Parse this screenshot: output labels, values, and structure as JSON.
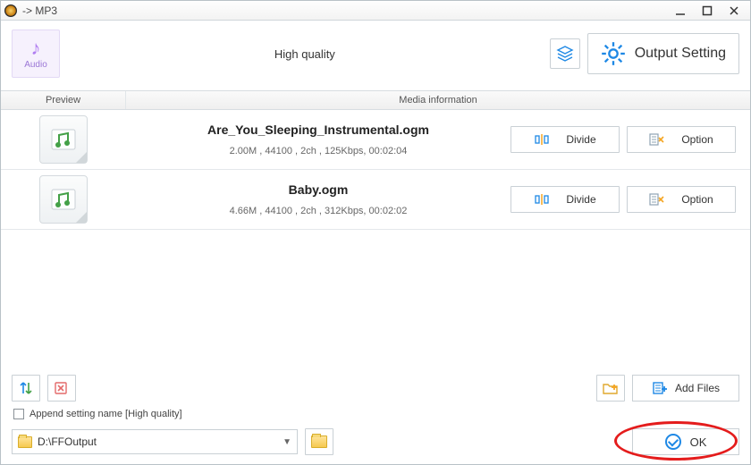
{
  "titlebar": {
    "title": " -> MP3"
  },
  "topbar": {
    "audio_label": "Audio",
    "quality_label": "High quality",
    "output_setting_label": "Output Setting"
  },
  "columns": {
    "preview": "Preview",
    "media": "Media information"
  },
  "files": [
    {
      "name": "Are_You_Sleeping_Instrumental.ogm",
      "meta": "2.00M , 44100 , 2ch , 125Kbps, 00:02:04"
    },
    {
      "name": "Baby.ogm",
      "meta": "4.66M , 44100 , 2ch , 312Kbps, 00:02:02"
    }
  ],
  "row_actions": {
    "divide": "Divide",
    "option": "Option"
  },
  "bottom": {
    "add_files": "Add Files",
    "append_label": "Append setting name [High quality]",
    "output_path": "D:\\FFOutput",
    "ok": "OK"
  },
  "colors": {
    "accent_blue": "#1e88e5",
    "accent_orange": "#f5a623",
    "accent_red": "#e41c1c",
    "accent_green": "#43a047"
  }
}
